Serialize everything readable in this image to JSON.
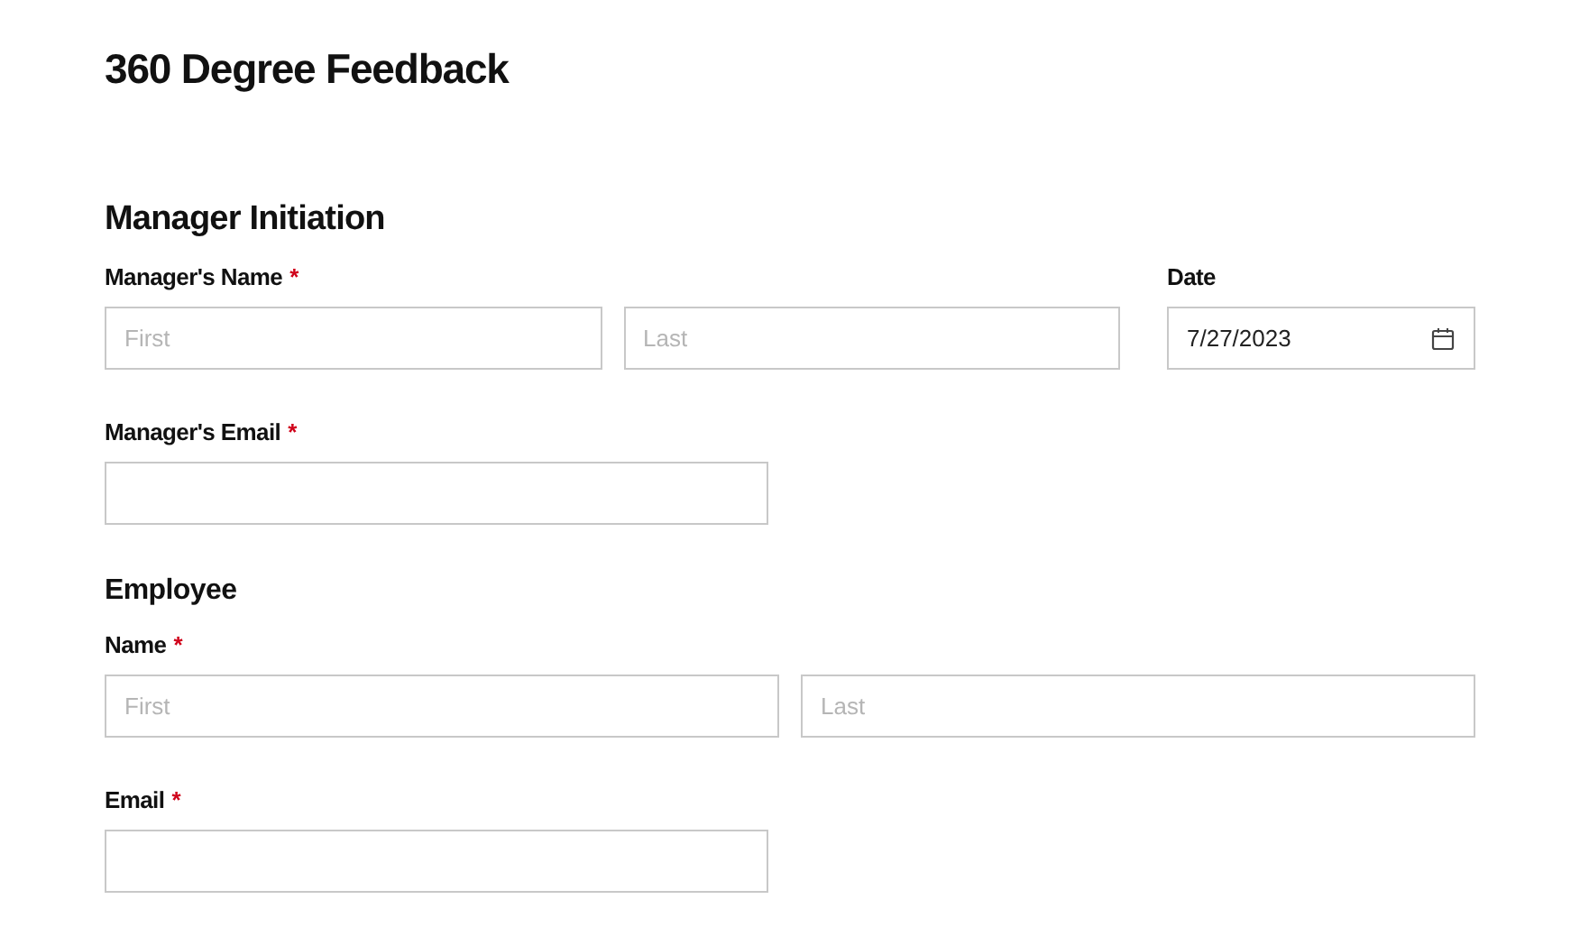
{
  "title": "360 Degree Feedback",
  "section": {
    "heading": "Manager Initiation"
  },
  "manager_name": {
    "label": "Manager's Name",
    "required_mark": "*",
    "first": {
      "placeholder": "First"
    },
    "last": {
      "placeholder": "Last"
    }
  },
  "date": {
    "label": "Date",
    "value": "7/27/2023"
  },
  "manager_email": {
    "label": "Manager's Email",
    "required_mark": "*"
  },
  "employee": {
    "heading": "Employee",
    "name": {
      "label": "Name",
      "required_mark": "*",
      "first": {
        "placeholder": "First"
      },
      "last": {
        "placeholder": "Last"
      }
    },
    "email": {
      "label": "Email",
      "required_mark": "*"
    }
  }
}
